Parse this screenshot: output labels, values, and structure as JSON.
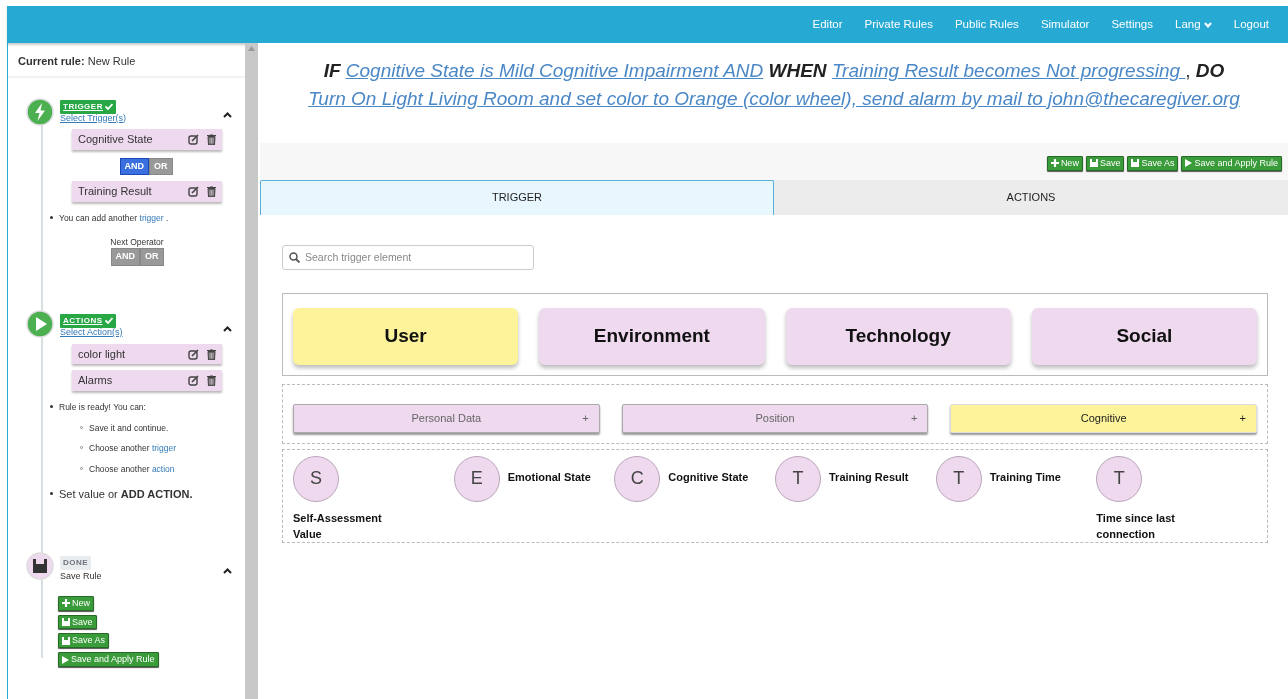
{
  "navbar": {
    "items": [
      {
        "label": "Editor",
        "kind": "link"
      },
      {
        "label": "Private Rules",
        "kind": "link"
      },
      {
        "label": "Public Rules",
        "kind": "link"
      },
      {
        "label": "Simulator",
        "kind": "link"
      },
      {
        "label": "Settings",
        "kind": "link"
      },
      {
        "label": "Lang",
        "kind": "dropdown"
      },
      {
        "label": "Logout",
        "kind": "link"
      }
    ]
  },
  "sidebar": {
    "current_rule_label": "Current rule:",
    "current_rule": "New Rule",
    "trigger_step": {
      "badge": "TRIGGER",
      "completed": true,
      "link": "Select Trigger(s)",
      "expanded": true,
      "items": [
        {
          "label": "Cognitive State"
        },
        {
          "label": "Training Result"
        }
      ],
      "operators": [
        {
          "label": "AND",
          "selected": true
        },
        {
          "label": "OR",
          "selected": false
        }
      ],
      "hint": {
        "text": "You can add another",
        "link": "trigger",
        "tail": "."
      },
      "next_operator_label": "Next Operator",
      "next_operators": [
        {
          "label": "AND",
          "selected": false
        },
        {
          "label": "OR",
          "selected": false
        }
      ]
    },
    "actions_step": {
      "badge": "ACTIONS",
      "completed": true,
      "link": "Select Action(s)",
      "expanded": true,
      "items": [
        {
          "label": "color light"
        },
        {
          "label": "Alarms"
        }
      ],
      "ready_text": "Rule is ready! You can:",
      "options": [
        {
          "text": "Save it and continue."
        },
        {
          "text": "Choose another",
          "link": "trigger"
        },
        {
          "text": "Choose another",
          "link": "action"
        }
      ],
      "set_value_text": "Set value or **ADD ACTION.**"
    },
    "done_step": {
      "badge": "DONE",
      "completed": false,
      "subtitle": "Save Rule",
      "expanded": true,
      "buttons": [
        {
          "label": "New",
          "kind": "new"
        },
        {
          "label": "Save",
          "kind": "save"
        },
        {
          "label": "Save As",
          "kind": "save"
        },
        {
          "label": "Save and Apply Rule",
          "kind": "apply"
        }
      ]
    }
  },
  "rule_sentence": [
    {
      "kind": "keyword",
      "text": "IF"
    },
    {
      "kind": "link",
      "text": "Cognitive State is Mild Cognitive Impairment AND"
    },
    {
      "kind": "keyword",
      "text": "WHEN"
    },
    {
      "kind": "link",
      "text": "Training Result becomes Not progressing "
    },
    {
      "kind": "plain",
      "text": ","
    },
    {
      "kind": "keyword",
      "text": "DO"
    },
    {
      "kind": "link",
      "text": "Turn On Light Living Room and set color to Orange (color wheel), send alarm by mail to john@thecaregiver.org"
    }
  ],
  "toolbar": [
    {
      "label": "New",
      "kind": "new"
    },
    {
      "label": "Save",
      "kind": "save"
    },
    {
      "label": "Save As",
      "kind": "save"
    },
    {
      "label": "Save and Apply Rule",
      "kind": "apply"
    }
  ],
  "tabs": [
    {
      "label": "TRIGGER",
      "selected": true
    },
    {
      "label": "ACTIONS",
      "selected": false
    }
  ],
  "search": {
    "placeholder": "Search trigger element"
  },
  "categories": [
    {
      "label": "User",
      "selected": true
    },
    {
      "label": "Environment",
      "selected": false
    },
    {
      "label": "Technology",
      "selected": false
    },
    {
      "label": "Social",
      "selected": false
    }
  ],
  "subcategories": [
    {
      "label": "Personal Data",
      "selected": false,
      "add": "+"
    },
    {
      "label": "Position",
      "selected": false,
      "add": "+"
    },
    {
      "label": "Cognitive",
      "selected": true,
      "add": "+"
    }
  ],
  "elements": [
    {
      "letter": "S",
      "label": "Self-Assessment Value",
      "kind": "below"
    },
    {
      "letter": "E",
      "label": "Emotional State",
      "kind": "beside"
    },
    {
      "letter": "C",
      "label": "Cognitive State",
      "kind": "beside"
    },
    {
      "letter": "T",
      "label": "Training Result",
      "kind": "beside"
    },
    {
      "letter": "T",
      "label": "Training Time",
      "kind": "beside"
    },
    {
      "letter": "T",
      "label": "Time since last connection",
      "kind": "below"
    }
  ]
}
